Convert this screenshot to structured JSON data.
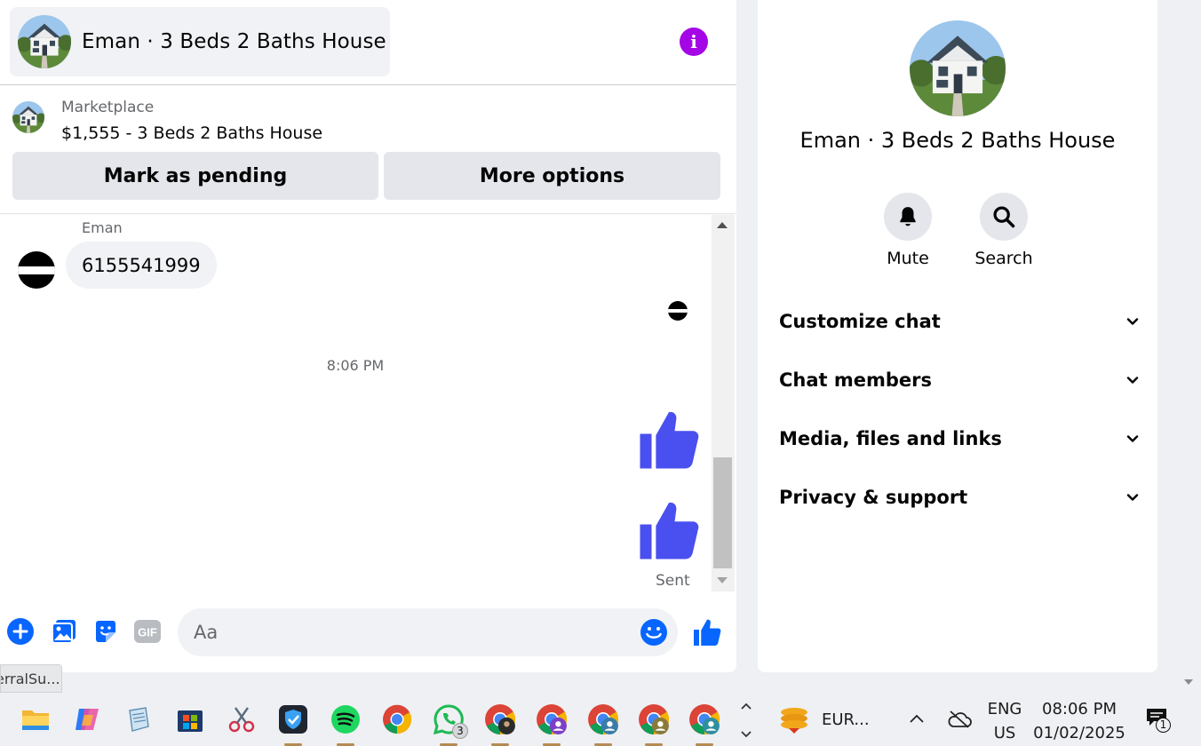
{
  "chat": {
    "title": "Eman · 3 Beds 2 Baths House",
    "marketplace_label": "Marketplace",
    "listing": "$1,555 - 3 Beds 2 Baths House",
    "mark_pending_label": "Mark as pending",
    "more_options_label": "More options"
  },
  "messages": {
    "sender_name": "Eman",
    "received_text": "6155541999",
    "timestamp": "8:06 PM",
    "status": "Sent"
  },
  "composer": {
    "placeholder": "Aa",
    "gif_label": "GIF"
  },
  "details": {
    "name": "Eman · 3 Beds 2 Baths House",
    "mute_label": "Mute",
    "search_label": "Search",
    "sections": [
      {
        "label": "Customize chat"
      },
      {
        "label": "Chat members"
      },
      {
        "label": "Media, files and links"
      },
      {
        "label": "Privacy & support"
      }
    ]
  },
  "status_bar": {
    "text": "erralSu..."
  },
  "taskbar": {
    "whatsapp_badge": "3",
    "tray_app_label": "EUR...",
    "language": "ENG",
    "region": "US",
    "time": "08:06 PM",
    "date": "01/02/2025",
    "notification_count": "1"
  },
  "colors": {
    "messenger_blue": "#0866ff",
    "thumb_purple": "#4a4fef",
    "info_purple": "#a406e6",
    "panel_bg": "#ffffff",
    "page_bg": "#eef0f3"
  }
}
